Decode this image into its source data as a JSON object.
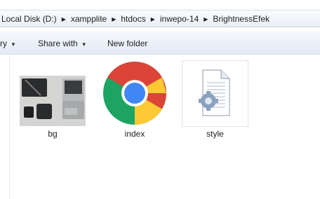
{
  "address_bar": {
    "crumbs": [
      "Local Disk (D:)",
      "xampplite",
      "htdocs",
      "inwepo-14",
      "BrightnessEfek"
    ]
  },
  "toolbar": {
    "organize_label": "ry",
    "share_label": "Share with",
    "new_folder_label": "New folder"
  },
  "files": [
    {
      "name": "bg",
      "icon": "laptop-photo-thumbnail"
    },
    {
      "name": "index",
      "icon": "chrome-icon"
    },
    {
      "name": "style",
      "icon": "css-file-icon"
    }
  ]
}
